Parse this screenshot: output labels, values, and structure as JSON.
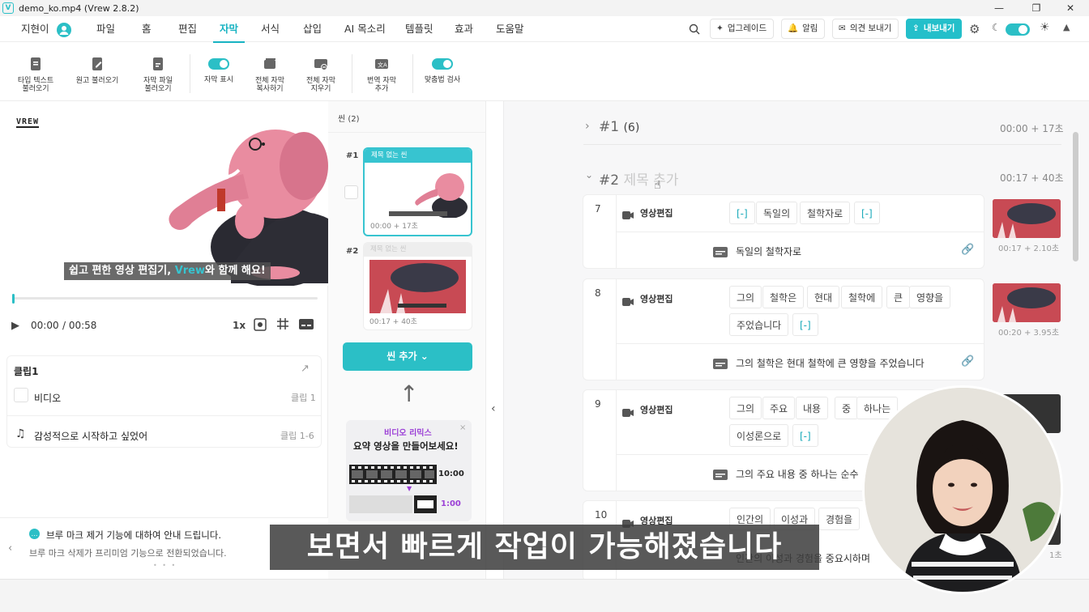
{
  "window": {
    "title": "demo_ko.mp4 (Vrew 2.8.2)",
    "app_icon": "V",
    "buttons": [
      "—",
      "❐",
      "✕"
    ]
  },
  "menubar": {
    "user": "지현이",
    "menus": [
      "파일",
      "홈",
      "편집",
      "자막",
      "서식",
      "삽입",
      "AI 목소리",
      "템플릿",
      "효과",
      "도움말"
    ],
    "active_menu": "자막",
    "upgrade_label": "업그레이드",
    "alarm_label": "알림",
    "feedback_label": "의견 보내기",
    "export_label": "내보내기"
  },
  "toolbar": {
    "tools": [
      {
        "label": "타입 텍스트\n불러오기",
        "icon": "type-text-icon"
      },
      {
        "label": "원고 불러오기",
        "icon": "script-icon"
      },
      {
        "label": "자막 파일\n불러오기",
        "icon": "subtitle-file-icon"
      },
      {
        "label": "자막 표시",
        "icon": "toggle"
      },
      {
        "label": "전체 자막\n복사하기",
        "icon": "copy-icon"
      },
      {
        "label": "전체 자막\n지우기",
        "icon": "erase-icon"
      },
      {
        "label": "번역 자막\n추가",
        "icon": "translate-icon"
      },
      {
        "label": "맞춤법 검사",
        "icon": "toggle"
      }
    ]
  },
  "preview": {
    "logo": "VREW",
    "caption_prefix": "쉽고 편한 영상 편집기, ",
    "caption_brand": "Vrew",
    "caption_suffix": "와 함께 해요!",
    "time_current": "00:00",
    "time_total": "/ 00:58",
    "speed": "1x",
    "progress": 0.0
  },
  "clips": {
    "title": "클립1",
    "rows": [
      {
        "label": "비디오",
        "meta": "클립 1"
      },
      {
        "label": "감성적으로 시작하고 싶었어",
        "meta": "클립 1-6"
      }
    ]
  },
  "notice": {
    "title": "브루 마크 제거 기능에 대하여 안내 드립니다.",
    "body": "브루 마크 삭제가 프리미엄 기능으로 전환되었습니다."
  },
  "scenes": {
    "header": "씬 (2)",
    "items": [
      {
        "num": "#1",
        "title": "제목 없는 씬",
        "time": "00:00 + 17초",
        "color": "#37c4d0"
      },
      {
        "num": "#2",
        "title": "제목 없는 씬",
        "time": "00:17 + 40초",
        "color": "#eeeeee"
      }
    ],
    "add_label": "씬 추가",
    "promo": {
      "title": "비디오 리믹스",
      "subtitle": "요약 영상을 만들어보세요!",
      "long": "10:00",
      "short": "1:00"
    }
  },
  "editor": {
    "scene1": {
      "heading": "#1",
      "count": "(6)",
      "time": "00:00 + 17초"
    },
    "scene2": {
      "heading": "#2",
      "placeholder": "제목 추가",
      "time": "00:17 + 40초"
    },
    "clip_label": "영상편집",
    "clips": [
      {
        "num": "7",
        "words": [
          "[-]",
          "독일의",
          "철학자로",
          "[-]"
        ],
        "subtitle": "독일의 철학자로",
        "time": "00:17 + 2.10초"
      },
      {
        "num": "8",
        "words": [
          "그의",
          "철학은",
          "현대",
          "철학에",
          "큰",
          "영향을",
          "주었습니다",
          "[-]"
        ],
        "subtitle": "그의 철학은 현대 철학에 큰 영향을 주었습니다",
        "time": "00:20 + 3.95초"
      },
      {
        "num": "9",
        "words": [
          "그의",
          "주요",
          "내용",
          "중",
          "하나는",
          "이성론으로",
          "[-]"
        ],
        "subtitle": "그의 주요 내용 중 하나는 순수",
        "time": ""
      },
      {
        "num": "10",
        "words": [
          "인간의",
          "이성과",
          "경험을"
        ],
        "subtitle": "인간의 이성과 경험을 중요시하며",
        "time": "1초"
      }
    ]
  },
  "overlay_caption": "보면서 빠르게 작업이 가능해졌습니다",
  "colors": {
    "accent": "#17b3c2",
    "export_bg": "#24bfca",
    "thumb_red": "#c84a54"
  }
}
